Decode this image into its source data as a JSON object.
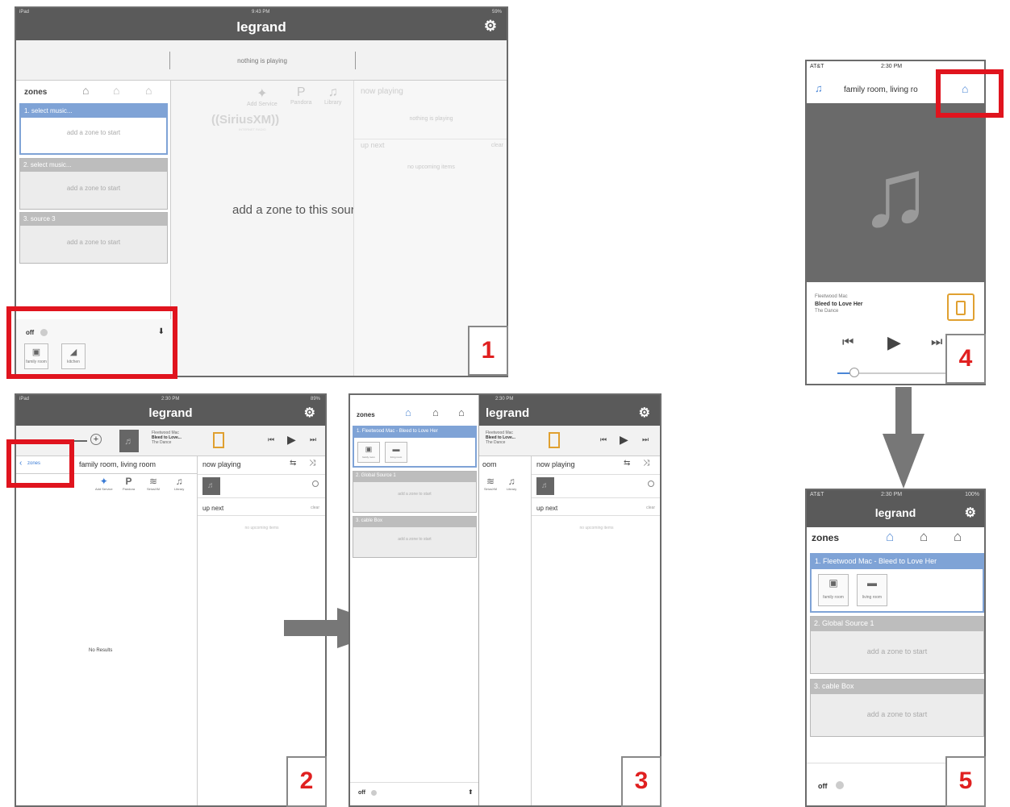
{
  "p1": {
    "status_left": "iPad",
    "status_time": "9:43 PM",
    "status_right": "59%",
    "brand": "legrand",
    "gear": "⚙",
    "nothing_playing": "nothing is playing",
    "zones_label": "zones",
    "zones": [
      {
        "header": "1. select music...",
        "body": "add a zone to start"
      },
      {
        "header": "2. select music...",
        "body": "add a zone to start"
      },
      {
        "header": "3. source 3",
        "body": "add a zone to start"
      }
    ],
    "sources": [
      "Add Service",
      "Pandora",
      "Library"
    ],
    "sirius": "((SiriusXM))",
    "sirius_sub": "INTERNET RADIO",
    "center_msg": "add a zone to this source to start",
    "now_playing": "now playing",
    "nothing_playing_faint": "nothing is playing",
    "up_next": "up next",
    "clear": "clear",
    "no_upcoming": "no upcoming items",
    "off": "off",
    "rooms": [
      {
        "icon": "▣",
        "label": "family room"
      },
      {
        "icon": "◢",
        "label": "kitchen"
      }
    ],
    "down_arrow": "⬇"
  },
  "p2": {
    "status_left": "iPad",
    "status_time": "2:30 PM",
    "status_right": "89%",
    "brand": "legrand",
    "gear": "⚙",
    "track_artist": "Fleetwood Mac",
    "track_title": "Bleed to Love...",
    "track_album": "The Dance",
    "zones_link": "zones",
    "room_title": "family room, living room",
    "now_playing": "now playing",
    "up_next": "up next",
    "clear": "clear",
    "no_upcoming": "no upcoming items",
    "sources": [
      "Add Service",
      "Pandora",
      "SiriusXM",
      "Library"
    ],
    "no_results": "No Results"
  },
  "p3": {
    "zones_label": "zones",
    "brand": "legrand",
    "gear": "⚙",
    "status_time": "2:30 PM",
    "zones": [
      {
        "header": "1. Fleetwood Mac - Bleed to Love Her",
        "rooms": [
          "family room",
          "living room"
        ]
      },
      {
        "header": "2. Global Source 1",
        "body": "add a zone to start"
      },
      {
        "header": "3. cable Box",
        "body": "add a zone to start"
      }
    ],
    "track_artist": "Fleetwood Mac",
    "track_title": "Bleed to Love...",
    "track_album": "The Dance",
    "partial_title": "oom",
    "now_playing": "now playing",
    "up_next": "up next",
    "clear": "clear",
    "no_upcoming": "no upcoming items",
    "sources": [
      "SiriusXM",
      "Library"
    ],
    "off": "off"
  },
  "p4": {
    "status_left": "AT&T",
    "status_time": "2:30 PM",
    "title": "family room, living ro",
    "track_artist": "Fleetwood Mac",
    "track_title": "Bleed to Love Her",
    "track_album": "The Dance",
    "progress": 0.15
  },
  "p5": {
    "status_left": "AT&T",
    "status_time": "2:30 PM",
    "status_right": "100%",
    "brand": "legrand",
    "gear": "⚙",
    "zones_label": "zones",
    "zones": [
      {
        "header": "1. Fleetwood Mac - Bleed to Love Her",
        "rooms": [
          "family room",
          "living room"
        ]
      },
      {
        "header": "2. Global Source 1",
        "body": "add a zone to start"
      },
      {
        "header": "3. cable Box",
        "body": "add a zone to start"
      }
    ],
    "off": "off"
  },
  "steps": [
    "1",
    "2",
    "3",
    "4",
    "5"
  ]
}
